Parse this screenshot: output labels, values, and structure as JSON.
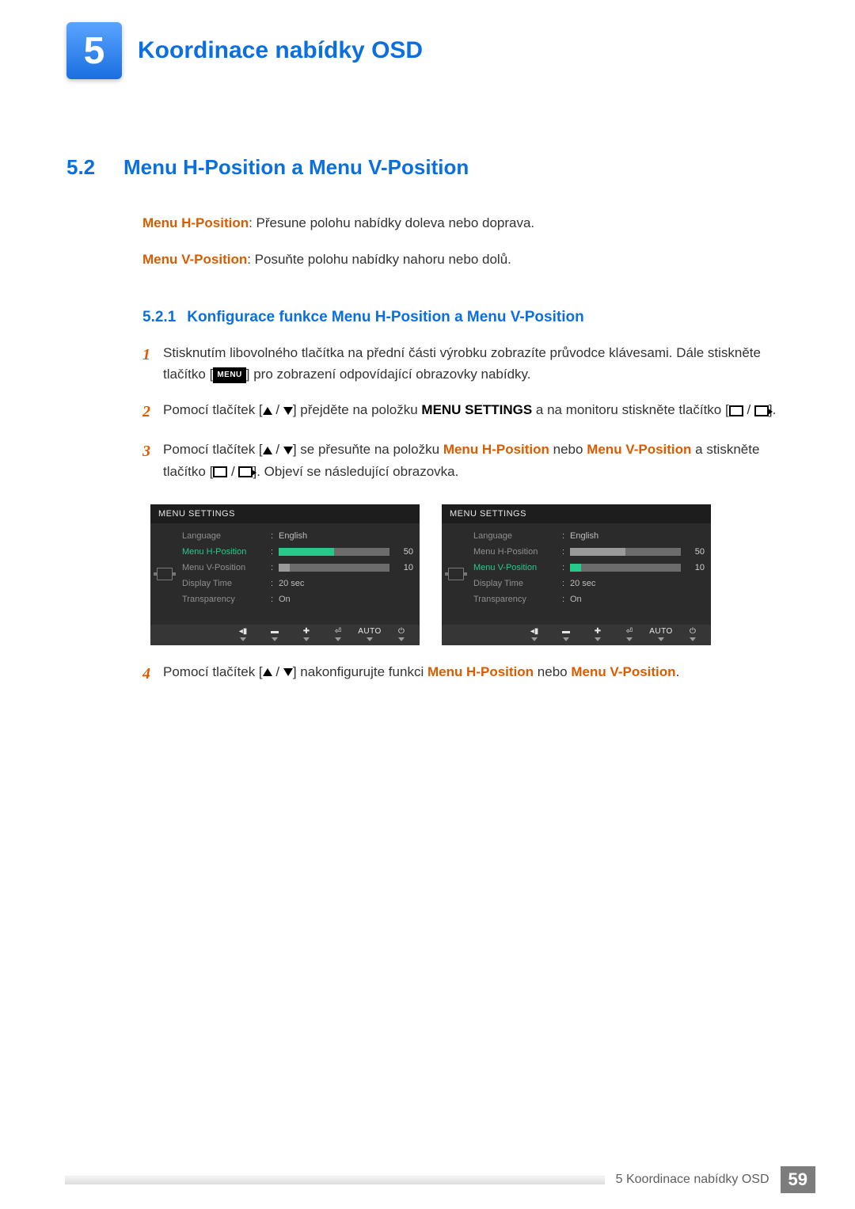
{
  "chapter": {
    "number": "5",
    "title": "Koordinace nabídky OSD"
  },
  "section": {
    "number": "5.2",
    "title": "Menu H-Position a Menu V-Position"
  },
  "intro": {
    "h_label": "Menu H-Position",
    "h_text": ": Přesune polohu nabídky doleva nebo doprava.",
    "v_label": "Menu V-Position",
    "v_text": ": Posuňte polohu nabídky nahoru nebo dolů."
  },
  "subsection": {
    "number": "5.2.1",
    "title": "Konfigurace funkce Menu H-Position a Menu V-Position"
  },
  "steps": {
    "s1": {
      "num": "1",
      "a": "Stisknutím libovolného tlačítka na přední části výrobku zobrazíte průvodce klávesami. Dále stiskněte tlačítko [",
      "b": "] pro zobrazení odpovídající obrazovky nabídky.",
      "chip": "MENU"
    },
    "s2": {
      "num": "2",
      "a": "Pomocí tlačítek [",
      "slash": " / ",
      "b": "] přejděte na položku ",
      "bold": "MENU SETTINGS",
      "c": " a na monitoru stiskněte tlačítko [",
      "d": "]."
    },
    "s3": {
      "num": "3",
      "a": "Pomocí tlačítek [",
      "slash": " / ",
      "b": "] se přesuňte na položku ",
      "h": "Menu H-Position",
      "mid": " nebo ",
      "v": "Menu V-Position",
      "c": " a stiskněte tlačítko [",
      "d": "]. Objeví se následující obrazovka."
    },
    "s4": {
      "num": "4",
      "a": "Pomocí tlačítek [",
      "slash": " / ",
      "b": "] nakonfigurujte funkci ",
      "h": "Menu H-Position",
      "mid": " nebo ",
      "v": "Menu V-Position",
      "end": "."
    }
  },
  "osd_common": {
    "title": "MENU SETTINGS",
    "labels": {
      "language": "Language",
      "h": "Menu H-Position",
      "v": "Menu V-Position",
      "display_time": "Display Time",
      "transparency": "Transparency"
    },
    "values": {
      "language": "English",
      "display_time": "20 sec",
      "transparency": "On",
      "h": "50",
      "v": "10"
    },
    "auto": "AUTO"
  },
  "chart_data": [
    {
      "type": "table",
      "title": "MENU SETTINGS (Menu H-Position active)",
      "active_item": "Menu H-Position",
      "rows": [
        {
          "label": "Language",
          "value": "English"
        },
        {
          "label": "Menu H-Position",
          "value": 50,
          "range": [
            0,
            100
          ],
          "highlighted": true
        },
        {
          "label": "Menu V-Position",
          "value": 10,
          "range": [
            0,
            100
          ]
        },
        {
          "label": "Display Time",
          "value": "20 sec"
        },
        {
          "label": "Transparency",
          "value": "On"
        }
      ]
    },
    {
      "type": "table",
      "title": "MENU SETTINGS (Menu V-Position active)",
      "active_item": "Menu V-Position",
      "rows": [
        {
          "label": "Language",
          "value": "English"
        },
        {
          "label": "Menu H-Position",
          "value": 50,
          "range": [
            0,
            100
          ]
        },
        {
          "label": "Menu V-Position",
          "value": 10,
          "range": [
            0,
            100
          ],
          "highlighted": true
        },
        {
          "label": "Display Time",
          "value": "20 sec"
        },
        {
          "label": "Transparency",
          "value": "On"
        }
      ]
    }
  ],
  "footer": {
    "text": "5 Koordinace nabídky OSD",
    "page": "59"
  }
}
